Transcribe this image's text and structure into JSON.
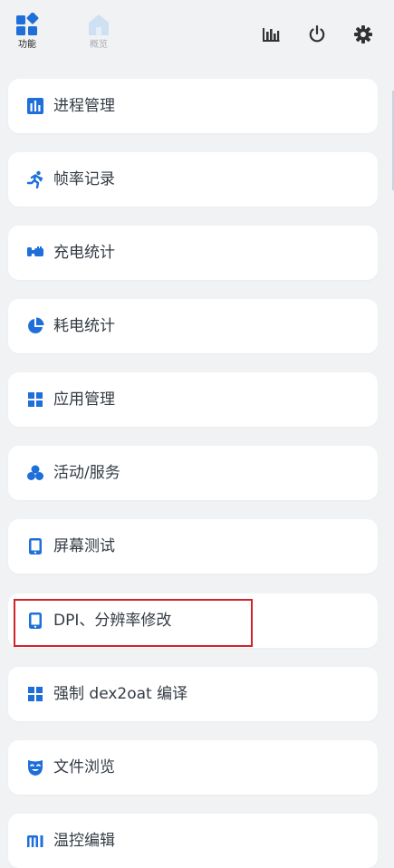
{
  "tabs": [
    {
      "label": "功能",
      "icon": "grid-diamond-icon",
      "active": true
    },
    {
      "label": "概览",
      "icon": "home-icon",
      "active": false
    }
  ],
  "toolbar": {
    "chart_icon": "bar-chart-icon",
    "power_icon": "power-icon",
    "settings_icon": "gear-icon"
  },
  "colors": {
    "accent": "#1e6fd9",
    "background": "#f1f2f4",
    "card": "#ffffff",
    "text": "#333b44",
    "highlight": "#d0242b"
  },
  "menu": [
    {
      "label": "进程管理",
      "icon": "bar-chart-icon"
    },
    {
      "label": "帧率记录",
      "icon": "running-person-icon"
    },
    {
      "label": "充电统计",
      "icon": "charger-plug-icon"
    },
    {
      "label": "耗电统计",
      "icon": "pie-chart-icon"
    },
    {
      "label": "应用管理",
      "icon": "apps-grid-icon"
    },
    {
      "label": "活动/服务",
      "icon": "circles-cluster-icon"
    },
    {
      "label": "屏幕测试",
      "icon": "phone-icon"
    },
    {
      "label": "DPI、分辨率修改",
      "icon": "phone-icon",
      "highlighted": true
    },
    {
      "label": "强制 dex2oat 编译",
      "icon": "apps-grid-icon"
    },
    {
      "label": "文件浏览",
      "icon": "theater-mask-icon"
    },
    {
      "label": "温控编辑",
      "icon": "mi-logo-icon"
    }
  ]
}
